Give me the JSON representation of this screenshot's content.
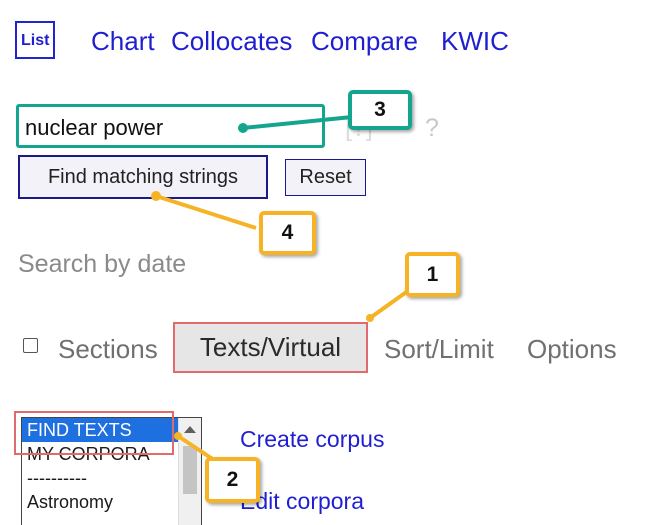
{
  "nav": {
    "items": [
      {
        "label": "List",
        "active": true
      },
      {
        "label": "Chart"
      },
      {
        "label": "Collocates"
      },
      {
        "label": "Compare"
      },
      {
        "label": "KWIC"
      }
    ]
  },
  "search": {
    "value": "nuclear power",
    "help_mark": "?",
    "find_label": "Find matching strings",
    "reset_label": "Reset",
    "date_label": "Search by date"
  },
  "tabs": {
    "sections_label": "Sections",
    "texts_label": "Texts/Virtual",
    "sort_label": "Sort/Limit",
    "options_label": "Options"
  },
  "corpora_list": {
    "options": [
      "FIND TEXTS",
      "MY CORPORA",
      "----------",
      "Astronomy"
    ],
    "selected": "FIND TEXTS"
  },
  "side_links": {
    "create": "Create corpus",
    "edit": "Edit corpora"
  },
  "callouts": [
    {
      "number": "1",
      "target": "texts-virtual-tab"
    },
    {
      "number": "2",
      "target": "find-texts-option"
    },
    {
      "number": "3",
      "target": "search-input"
    },
    {
      "number": "4",
      "target": "find-matching-strings-button"
    }
  ],
  "colors": {
    "link": "#1f1fd1",
    "callout_orange": "#f5b325",
    "callout_teal": "#14a58e",
    "highlight_red": "#e36a6a",
    "selected_blue": "#1e6fe0"
  }
}
